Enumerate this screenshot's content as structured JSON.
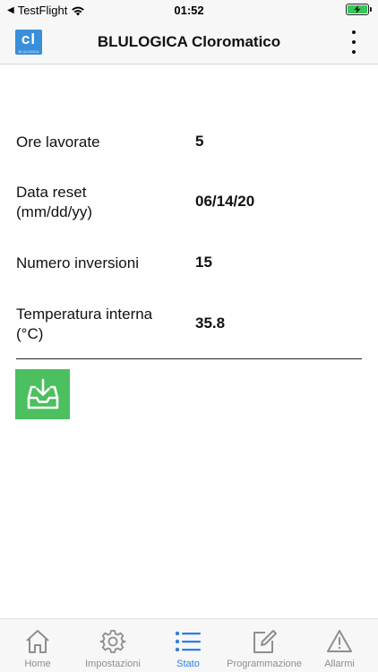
{
  "statusbar": {
    "back_app": "TestFlight",
    "time": "01:52"
  },
  "header": {
    "logo_letters": "cl",
    "logo_sub": "BLULOGICA",
    "title": "BLULOGICA Cloromatico"
  },
  "status": {
    "rows": [
      {
        "label": "Ore lavorate",
        "value": "5"
      },
      {
        "label": "Data reset\n(mm/dd/yy)",
        "value": "06/14/20"
      },
      {
        "label": "Numero inversioni",
        "value": "15"
      },
      {
        "label": "Temperatura interna\n(°C)",
        "value": "35.8"
      }
    ]
  },
  "tabs": [
    {
      "label": "Home",
      "icon": "home-icon"
    },
    {
      "label": "Impostazioni",
      "icon": "gear-icon"
    },
    {
      "label": "Stato",
      "icon": "list-icon",
      "active": true
    },
    {
      "label": "Programmazione",
      "icon": "edit-icon"
    },
    {
      "label": "Allarmi",
      "icon": "warning-icon"
    }
  ],
  "colors": {
    "accent": "#2d7ee8",
    "download_button": "#4cbf5f",
    "logo": "#3a8fd8",
    "inactive_tab": "#8e8e93"
  }
}
